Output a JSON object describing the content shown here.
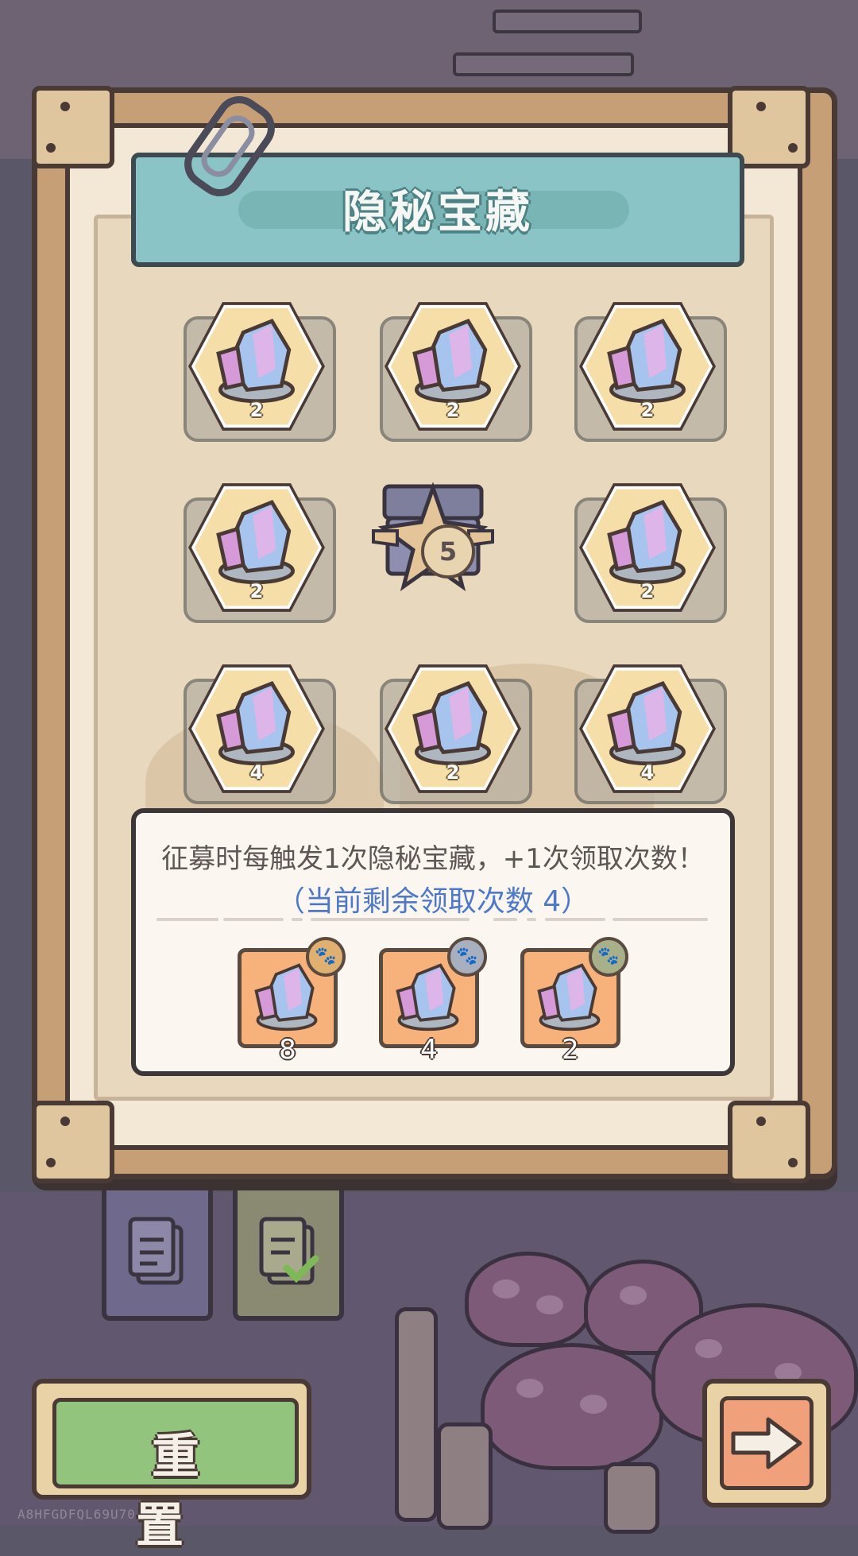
{
  "title": "隐秘宝藏",
  "grid": {
    "tiles": [
      {
        "type": "crystal",
        "count": "2"
      },
      {
        "type": "crystal",
        "count": "2"
      },
      {
        "type": "crystal",
        "count": "2"
      },
      {
        "type": "crystal",
        "count": "2"
      },
      {
        "type": "chest",
        "count": "5"
      },
      {
        "type": "crystal",
        "count": "2"
      },
      {
        "type": "crystal",
        "count": "4"
      },
      {
        "type": "crystal",
        "count": "2"
      },
      {
        "type": "crystal",
        "count": "4"
      }
    ]
  },
  "info": {
    "description": "征募时每触发1次隐秘宝藏，+1次领取次数！",
    "remaining": "（当前剩余领取次数  4）"
  },
  "rewards": [
    {
      "count": "8",
      "badge_icon": "paw-gold-icon",
      "badge_color": "#e0b070"
    },
    {
      "count": "4",
      "badge_icon": "paw-silver-icon",
      "badge_color": "#a8b0c0"
    },
    {
      "count": "2",
      "badge_icon": "paw-bronze-icon",
      "badge_color": "#a8b08a"
    }
  ],
  "tabs": [
    {
      "icon": "document-icon"
    },
    {
      "icon": "document-check-icon"
    }
  ],
  "buttons": {
    "reset_label": "重 置",
    "next_icon": "arrow-right-icon"
  },
  "watermark": "A8HFGDFQL69U70",
  "colors": {
    "banner": "#8ac4c6",
    "accent_text": "#4e78c8",
    "reset_green": "#93c47d",
    "next_orange": "#f0a07a"
  }
}
